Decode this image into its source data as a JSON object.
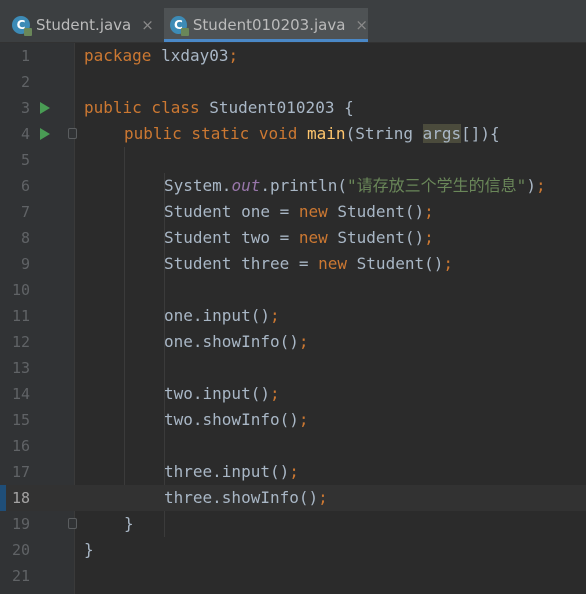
{
  "tabs": [
    {
      "label": "Student.java",
      "icon": "class-icon",
      "icon_letter": "C",
      "close": "×"
    },
    {
      "label": "Student010203.java",
      "icon": "class-icon",
      "icon_letter": "C",
      "close": "×",
      "active": true
    }
  ],
  "gutter": {
    "line_numbers": [
      "1",
      "2",
      "3",
      "4",
      "5",
      "6",
      "7",
      "8",
      "9",
      "10",
      "11",
      "12",
      "13",
      "14",
      "15",
      "16",
      "17",
      "18",
      "19",
      "20",
      "21"
    ],
    "current_line": "18"
  },
  "code": {
    "l1": {
      "kw": "package",
      "rest": " lxday03",
      "semi": ";"
    },
    "l3": {
      "kw": "public class",
      "name": " Student010203 {"
    },
    "l4": {
      "kw1": "public static void",
      "fn": "main",
      "p1": "(String ",
      "param": "args",
      "p2": "[]){"
    },
    "l6": {
      "a": "System.",
      "field": "out",
      "b": ".println(",
      "str": "\"请存放三个学生的信息\"",
      "c": ")",
      "semi": ";"
    },
    "l7": {
      "a": "Student one = ",
      "kw": "new",
      "b": " Student()",
      "semi": ";"
    },
    "l8": {
      "a": "Student two = ",
      "kw": "new",
      "b": " Student()",
      "semi": ";"
    },
    "l9": {
      "a": "Student three = ",
      "kw": "new",
      "b": " Student()",
      "semi": ";"
    },
    "l11": {
      "a": "one.input()",
      "semi": ";"
    },
    "l12": {
      "a": "one.showInfo()",
      "semi": ";"
    },
    "l14": {
      "a": "two.input()",
      "semi": ";"
    },
    "l15": {
      "a": "two.showInfo()",
      "semi": ";"
    },
    "l17": {
      "a": "three.input()",
      "semi": ";"
    },
    "l18": {
      "a": "three.showInfo()",
      "semi": ";"
    },
    "l19": {
      "a": "}"
    },
    "l20": {
      "a": "}"
    }
  },
  "colors": {
    "background": "#2b2b2b",
    "keyword": "#cc7832",
    "function": "#ffc66d",
    "string": "#6a8759",
    "field": "#9876aa",
    "text": "#a9b7c6",
    "line_number": "#606366"
  }
}
